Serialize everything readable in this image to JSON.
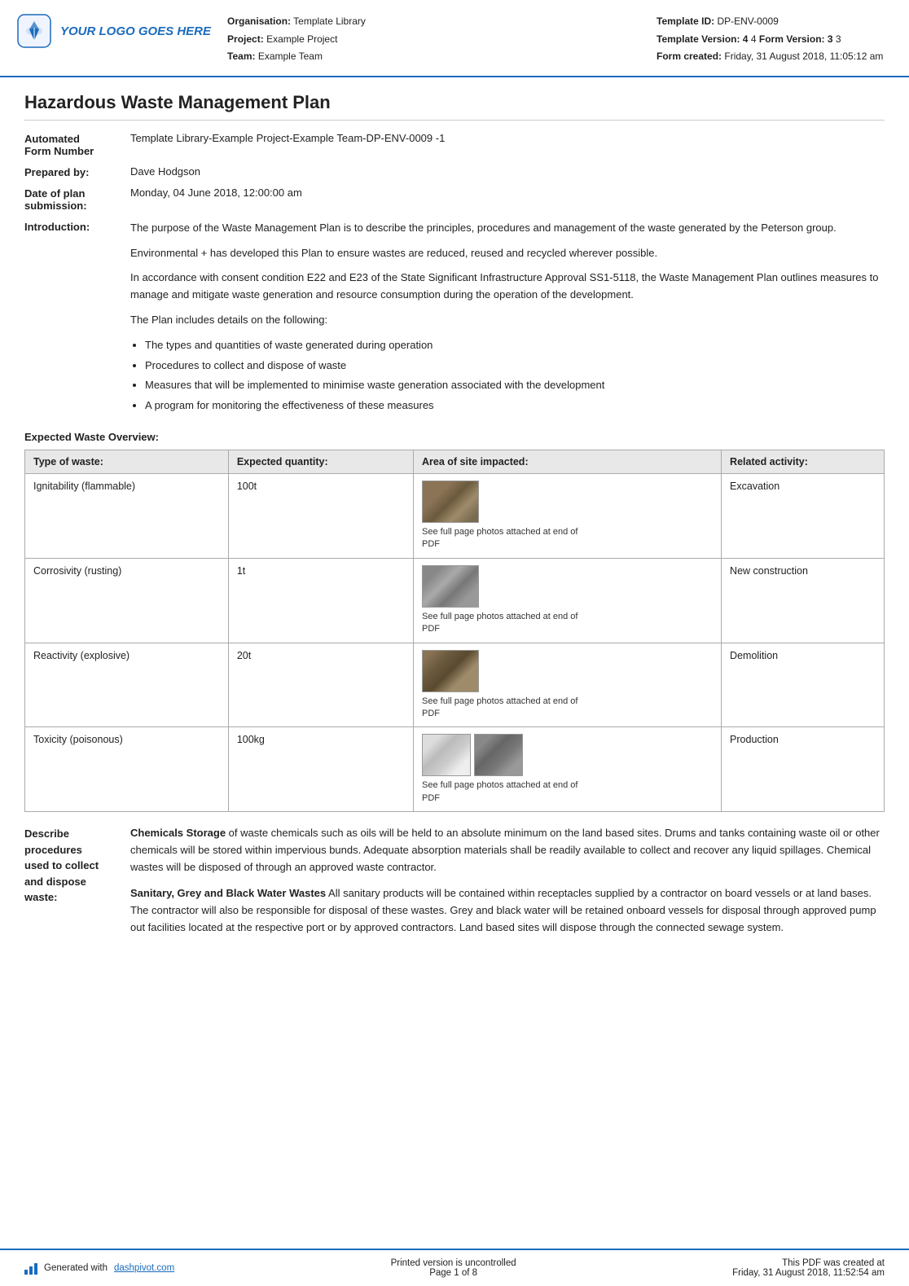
{
  "header": {
    "logo_text": "YOUR LOGO GOES HERE",
    "org_label": "Organisation:",
    "org_value": "Template Library",
    "project_label": "Project:",
    "project_value": "Example Project",
    "team_label": "Team:",
    "team_value": "Example Team",
    "template_id_label": "Template ID:",
    "template_id_value": "DP-ENV-0009",
    "template_version_label": "Template Version:",
    "template_version_value": "4",
    "form_version_label": "Form Version:",
    "form_version_value": "3",
    "form_created_label": "Form created:",
    "form_created_value": "Friday, 31 August 2018, 11:05:12 am"
  },
  "document": {
    "title": "Hazardous Waste Management Plan",
    "automated_label": "Automated\nForm Number",
    "automated_value": "Template Library-Example Project-Example Team-DP-ENV-0009   -1",
    "prepared_by_label": "Prepared by:",
    "prepared_by_value": "Dave Hodgson",
    "date_label": "Date of plan\nsubmission:",
    "date_value": "Monday, 04 June 2018, 12:00:00 am",
    "intro_label": "Introduction:",
    "intro_paragraphs": [
      "The purpose of the Waste Management Plan is to describe the principles, procedures and management of the waste generated by the Peterson group.",
      "Environmental + has developed this Plan to ensure wastes are reduced, reused and recycled wherever possible.",
      "In accordance with consent condition E22 and E23 of the State Significant Infrastructure Approval SS1-5118, the Waste Management Plan outlines measures to manage and mitigate waste generation and resource consumption during the operation of the development.",
      "The Plan includes details on the following:"
    ],
    "intro_bullets": [
      "The types and quantities of waste generated during operation",
      "Procedures to collect and dispose of waste",
      "Measures that will be implemented to minimise waste generation associated with the development",
      "A program for monitoring the effectiveness of these measures"
    ]
  },
  "waste_overview": {
    "heading": "Expected Waste Overview:",
    "columns": [
      "Type of waste:",
      "Expected quantity:",
      "Area of site impacted:",
      "Related activity:"
    ],
    "rows": [
      {
        "type": "Ignitability (flammable)",
        "quantity": "100t",
        "photo_caption": "See full page photos attached at end of PDF",
        "activity": "Excavation"
      },
      {
        "type": "Corrosivity (rusting)",
        "quantity": "1t",
        "photo_caption": "See full page photos attached at end of PDF",
        "activity": "New construction"
      },
      {
        "type": "Reactivity (explosive)",
        "quantity": "20t",
        "photo_caption": "See full page photos attached at end of PDF",
        "activity": "Demolition"
      },
      {
        "type": "Toxicity (poisonous)",
        "quantity": "100kg",
        "photo_caption": "See full page photos attached at end of PDF",
        "activity": "Production"
      }
    ]
  },
  "procedures": {
    "label": "Describe\nprocedures\nused to collect\nand dispose\nwaste:",
    "paragraph1_bold": "Chemicals Storage",
    "paragraph1_rest": " of waste chemicals such as oils will be held to an absolute minimum on the land based sites. Drums and tanks containing waste oil or other chemicals will be stored within impervious bunds. Adequate absorption materials shall be readily available to collect and recover any liquid spillages. Chemical wastes will be disposed of through an approved waste contractor.",
    "paragraph2_bold": "Sanitary, Grey and Black Water Wastes",
    "paragraph2_rest": " All sanitary products will be contained within receptacles supplied by a contractor on board vessels or at land bases. The contractor will also be responsible for disposal of these wastes. Grey and black water will be retained onboard vessels for disposal through approved pump out facilities located at the respective port or by approved contractors. Land based sites will dispose through the connected sewage system."
  },
  "footer": {
    "generated_text": "Generated with ",
    "link_text": "dashpivot.com",
    "uncontrolled_text": "Printed version is uncontrolled",
    "page_text": "Page 1 of 8",
    "pdf_created_text": "This PDF was created at",
    "pdf_created_date": "Friday, 31 August 2018, 11:52:54 am"
  }
}
